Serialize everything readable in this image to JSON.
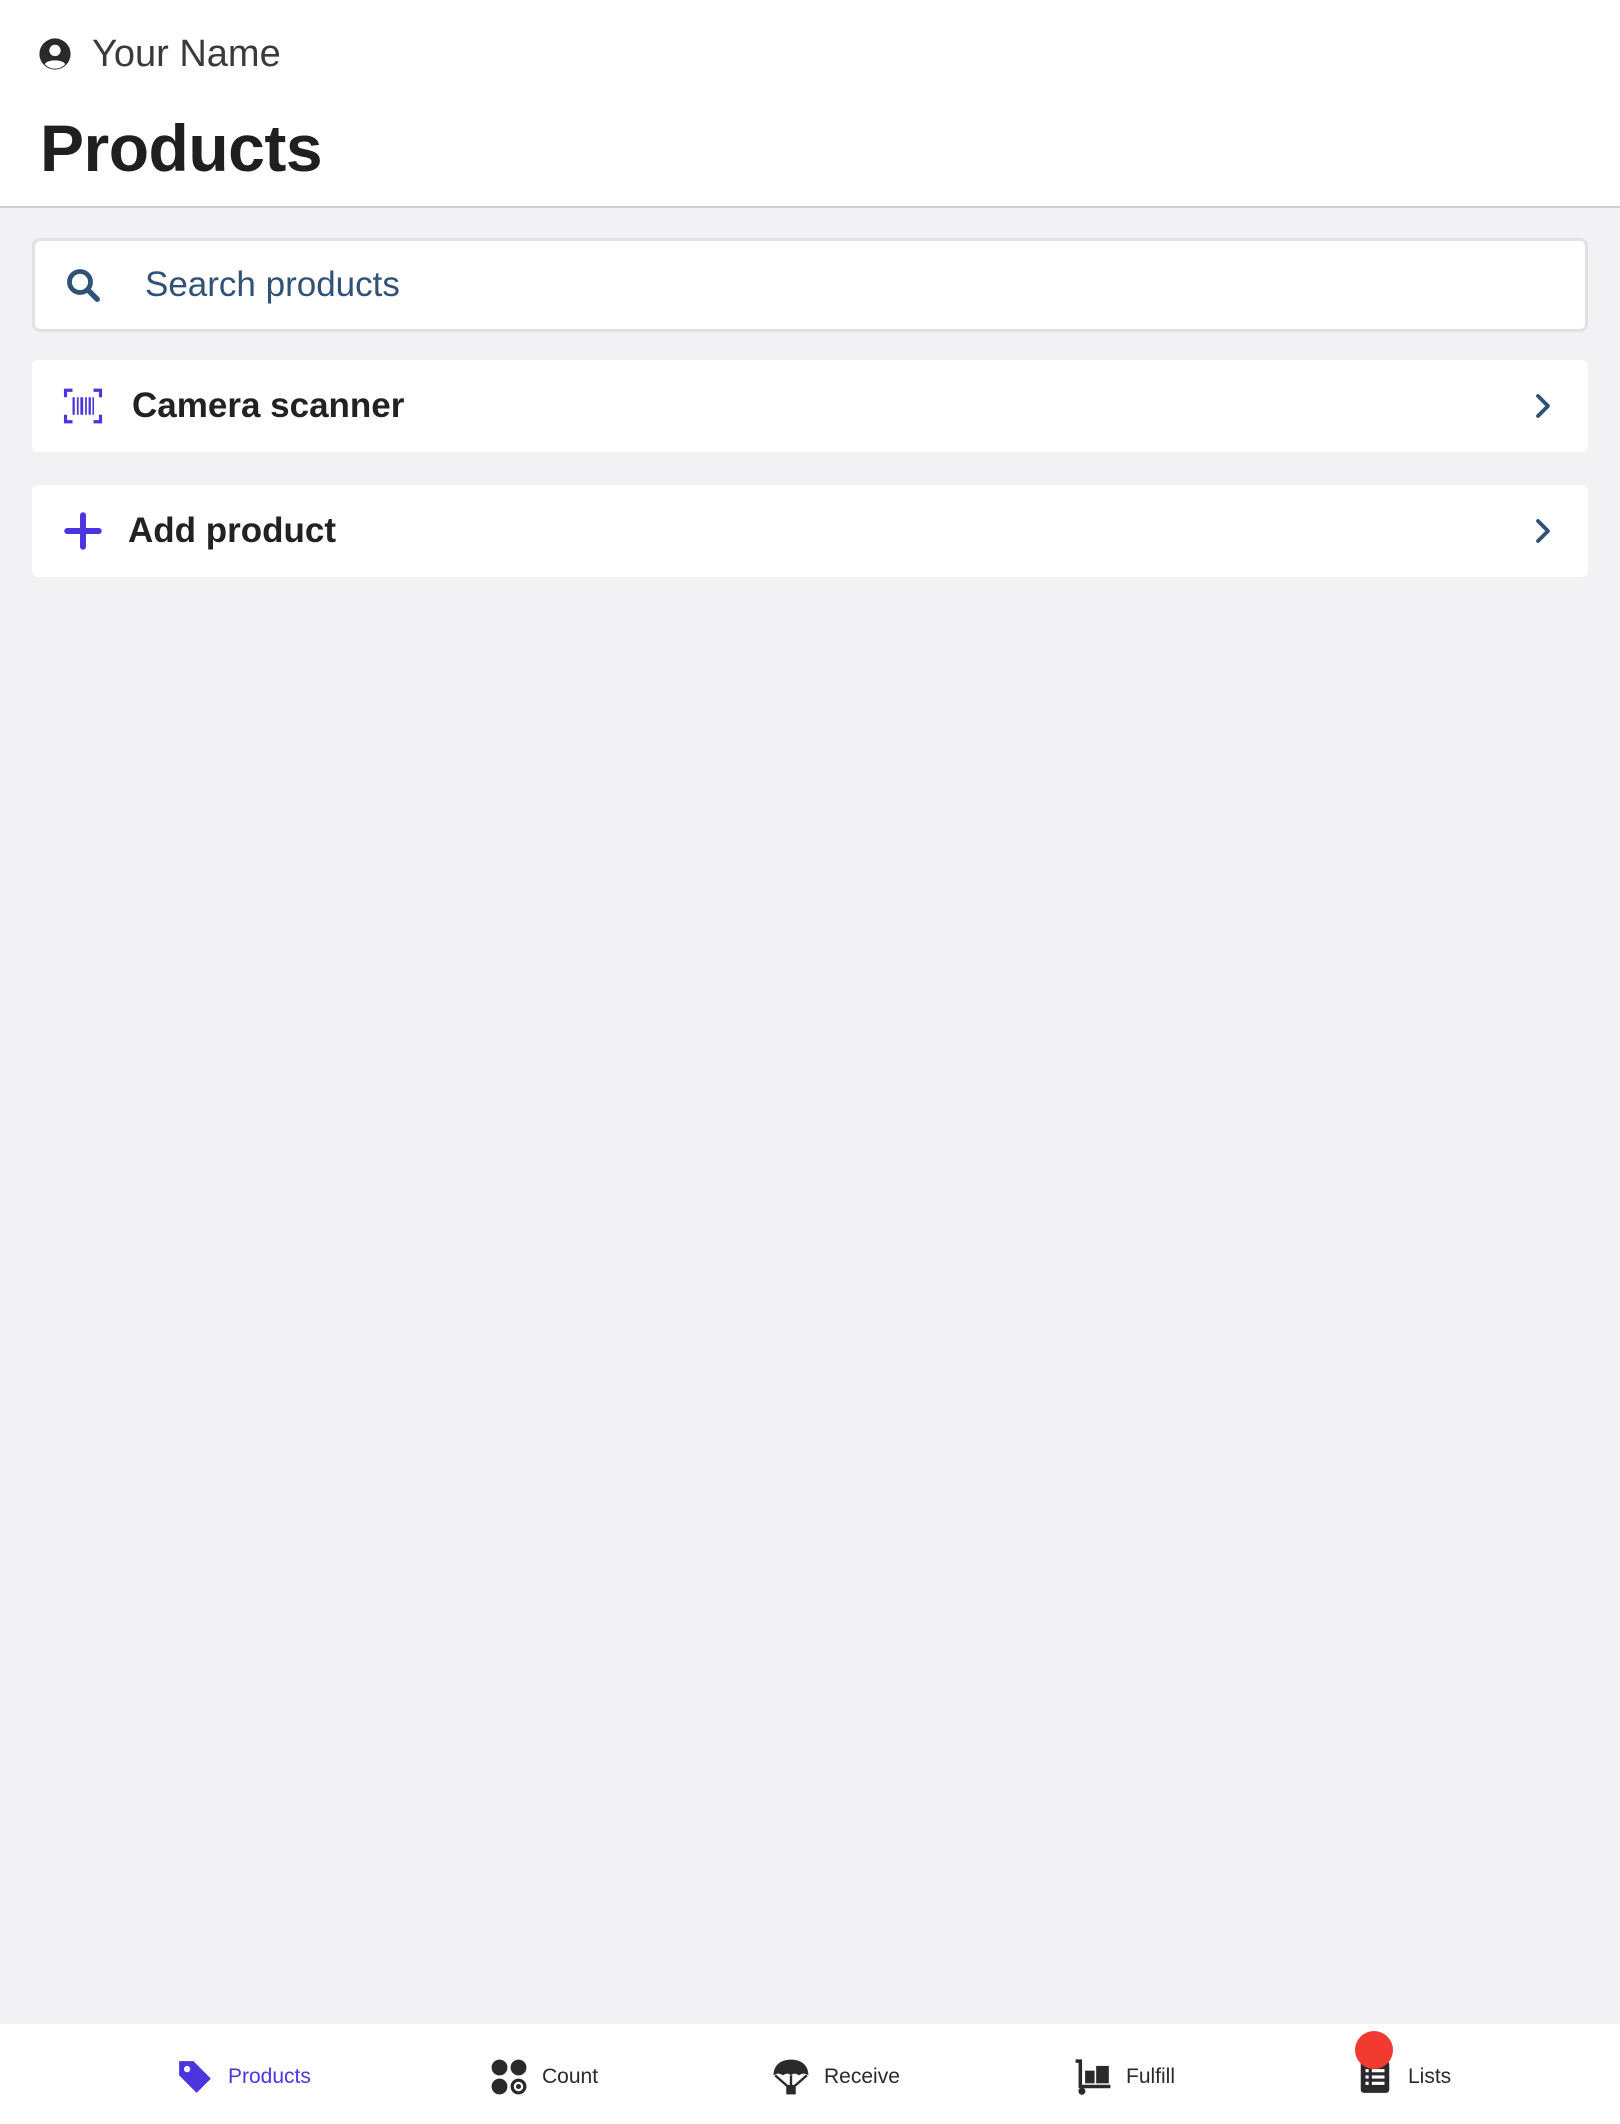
{
  "header": {
    "user_name": "Your Name",
    "title": "Products",
    "user_icon": "account-circle-icon"
  },
  "search": {
    "placeholder": "Search products",
    "icon": "search-icon"
  },
  "actions": [
    {
      "label": "Camera scanner",
      "icon": "barcode-scan-icon"
    },
    {
      "label": "Add product",
      "icon": "plus-icon"
    }
  ],
  "tabs": [
    {
      "label": "Products",
      "icon": "tag-icon",
      "active": true
    },
    {
      "label": "Count",
      "icon": "count-icon",
      "active": false
    },
    {
      "label": "Receive",
      "icon": "parachute-icon",
      "active": false
    },
    {
      "label": "Fulfill",
      "icon": "dolly-icon",
      "active": false
    },
    {
      "label": "Lists",
      "icon": "list-icon",
      "active": false,
      "badge": true
    }
  ],
  "colors": {
    "accent": "#4b35e0",
    "search_text": "#2f5276",
    "badge": "#f23a30",
    "background": "#f2f1f4"
  }
}
